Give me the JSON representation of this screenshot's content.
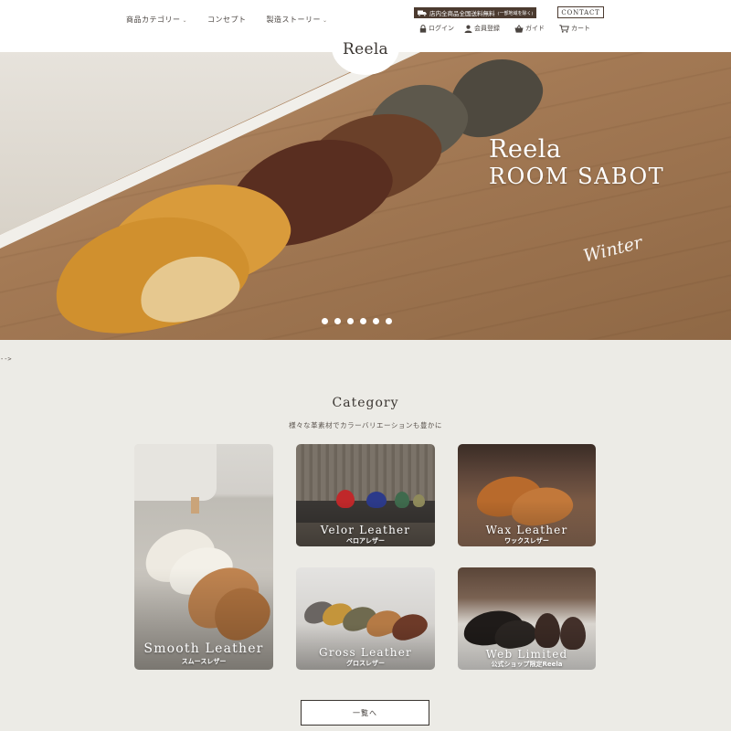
{
  "header": {
    "nav": [
      {
        "label": "商品カテゴリー",
        "has_caret": true
      },
      {
        "label": "コンセプト",
        "has_caret": false
      },
      {
        "label": "製造ストーリー",
        "has_caret": true
      }
    ],
    "shipping_text": "店内全商品全国送料無料",
    "shipping_note": "(一部地域を除く)",
    "contact_label": "CONTACT",
    "login_label": "ログイン",
    "register_label": "会員登録",
    "guide_label": "ガイド",
    "cart_label": "カート",
    "logo": "Reela"
  },
  "hero": {
    "title_line1": "Reela",
    "title_line2": "ROOM SABOT",
    "script": "Winter",
    "slide_count": 6
  },
  "stray_text": "-->",
  "category": {
    "title": "Category",
    "subtitle": "様々な革素材でカラーバリエーションも豊かに",
    "cards": [
      {
        "en": "Smooth Leather",
        "jp": "スムースレザー"
      },
      {
        "en": "Velor Leather",
        "jp": "ベロアレザー"
      },
      {
        "en": "Wax Leather",
        "jp": "ワックスレザー"
      },
      {
        "en": "Gross Leather",
        "jp": "グロスレザー"
      },
      {
        "en": "Web Limited",
        "jp": "公式ショップ限定Reela"
      }
    ],
    "view_all_label": "一覧へ"
  },
  "colors": {
    "header_bg": "#ffffff",
    "page_bg": "#ecebe6",
    "badge_bg": "#4b3a2f"
  }
}
